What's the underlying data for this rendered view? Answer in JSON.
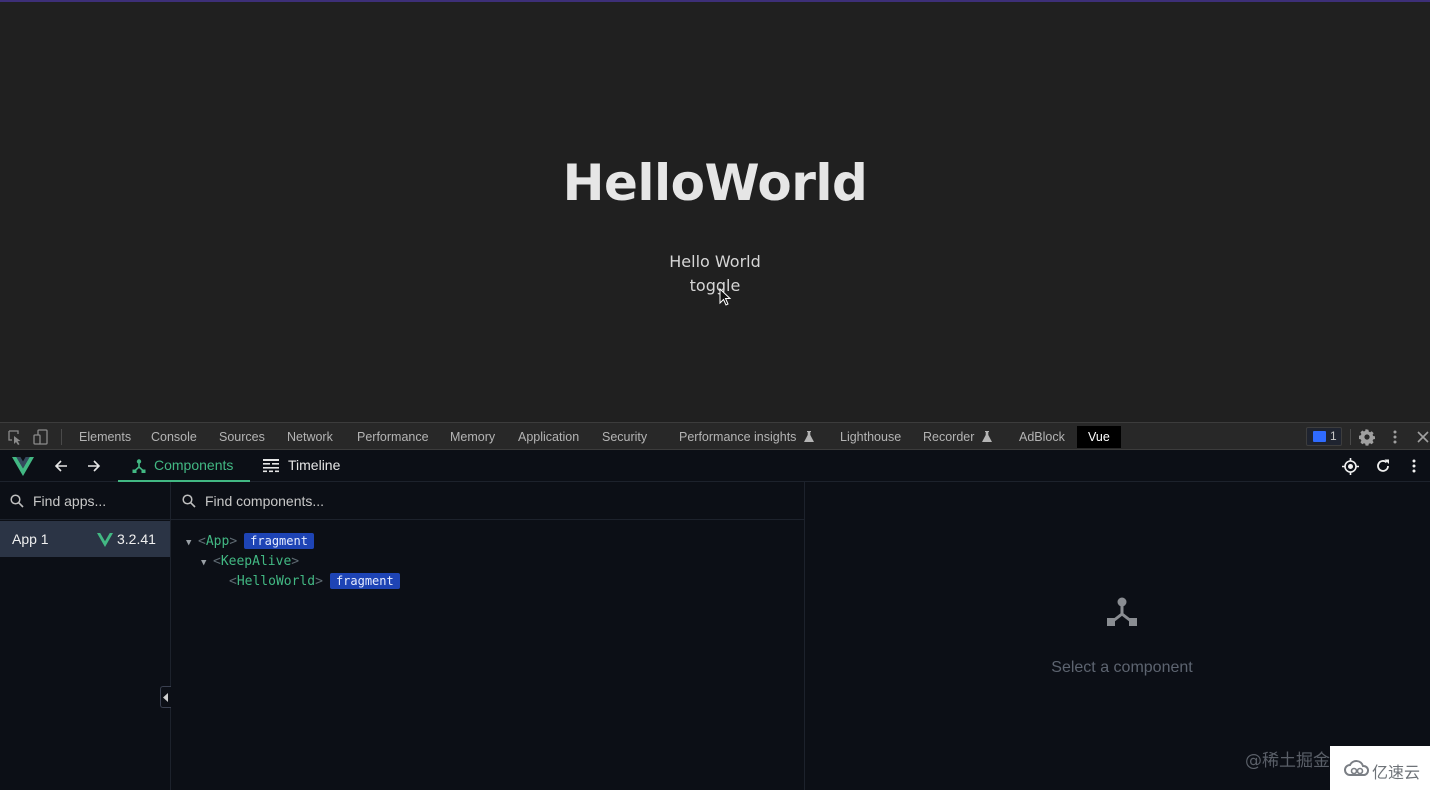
{
  "page": {
    "title": "HelloWorld",
    "subtitle": "Hello World",
    "toggle_label": "toggle"
  },
  "devtools": {
    "tabs": [
      {
        "label": "Elements"
      },
      {
        "label": "Console"
      },
      {
        "label": "Sources"
      },
      {
        "label": "Network"
      },
      {
        "label": "Performance"
      },
      {
        "label": "Memory"
      },
      {
        "label": "Application"
      },
      {
        "label": "Security"
      },
      {
        "label": "Performance insights",
        "experimental": true
      },
      {
        "label": "Lighthouse"
      },
      {
        "label": "Recorder",
        "experimental": true
      },
      {
        "label": "AdBlock"
      },
      {
        "label": "Vue",
        "active": true
      }
    ],
    "issues_count": "1",
    "icons": [
      "inspect-element-icon",
      "device-toggle-icon",
      "issues-icon",
      "settings-gear-icon",
      "more-vertical-icon",
      "close-icon"
    ]
  },
  "vue": {
    "tabs": {
      "components": "Components",
      "timeline": "Timeline"
    },
    "apps_search_placeholder": "Find apps...",
    "components_search_placeholder": "Find components...",
    "apps": [
      {
        "name": "App 1",
        "version": "3.2.41"
      }
    ],
    "tree": [
      {
        "name": "App",
        "badge": "fragment",
        "expanded": true
      },
      {
        "name": "KeepAlive",
        "expanded": true
      },
      {
        "name": "HelloWorld",
        "badge": "fragment"
      }
    ],
    "inspector_empty": "Select a component",
    "accent": "#42b883"
  },
  "watermarks": {
    "left": "@稀土掘金",
    "right": "亿速云"
  }
}
